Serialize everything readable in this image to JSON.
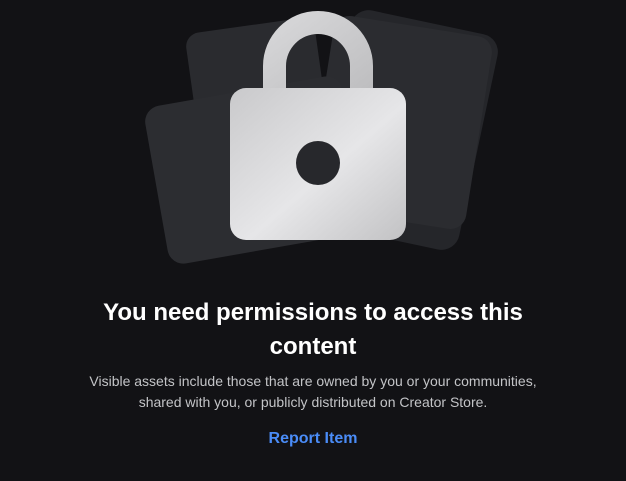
{
  "permission_notice": {
    "illustration_icon": "lock-icon",
    "title_lines": [
      "You need permissions to access this",
      "content"
    ],
    "description_lines": [
      "Visible assets include those that are owned by you or your communities,",
      "shared with you, or publicly distributed on Creator Store."
    ],
    "report_link_label": "Report Item"
  },
  "colors": {
    "background": "#121215",
    "title": "#ffffff",
    "description": "#c3c4c7",
    "link": "#4a8cf7",
    "card": "#2a2b2f",
    "lock_body": "#cfcfd1"
  }
}
